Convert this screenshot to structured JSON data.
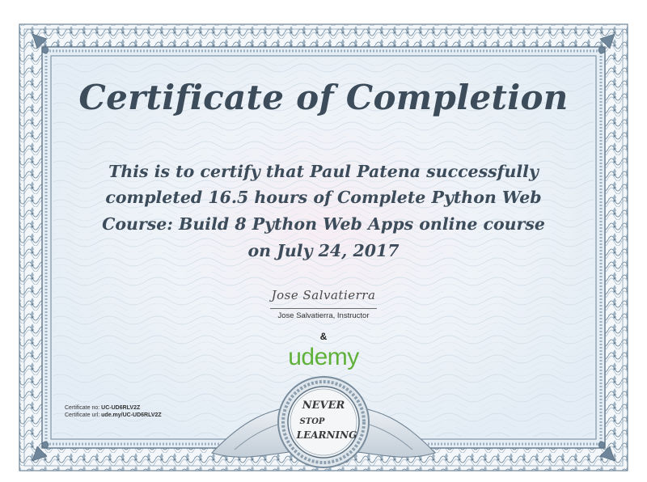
{
  "certificate": {
    "title": "Certificate of Completion",
    "body_lines": [
      "This is to certify that Paul Patena successfully",
      "completed 16.5 hours of Complete Python Web",
      "Course: Build 8 Python Web Apps online course",
      "on July 24, 2017"
    ],
    "signature_script": "Jose Salvatierra",
    "signature_caption": "Jose Salvatierra, Instructor",
    "ampersand": "&",
    "brand": "udemy",
    "cert_no_label": "Certificate no:",
    "cert_no_value": "UC-UD6RLV2Z",
    "cert_url_label": "Certificate url:",
    "cert_url_value": "ude.my/UC-UD6RLV2Z",
    "seal_lines": [
      "NEVER",
      "STOP",
      "LEARNING"
    ]
  },
  "colors": {
    "border": "#8fa4b6",
    "border_dark": "#5d7388",
    "panel": "#eaf2f8",
    "text": "#3d4c5a",
    "brand": "#60b13a"
  }
}
